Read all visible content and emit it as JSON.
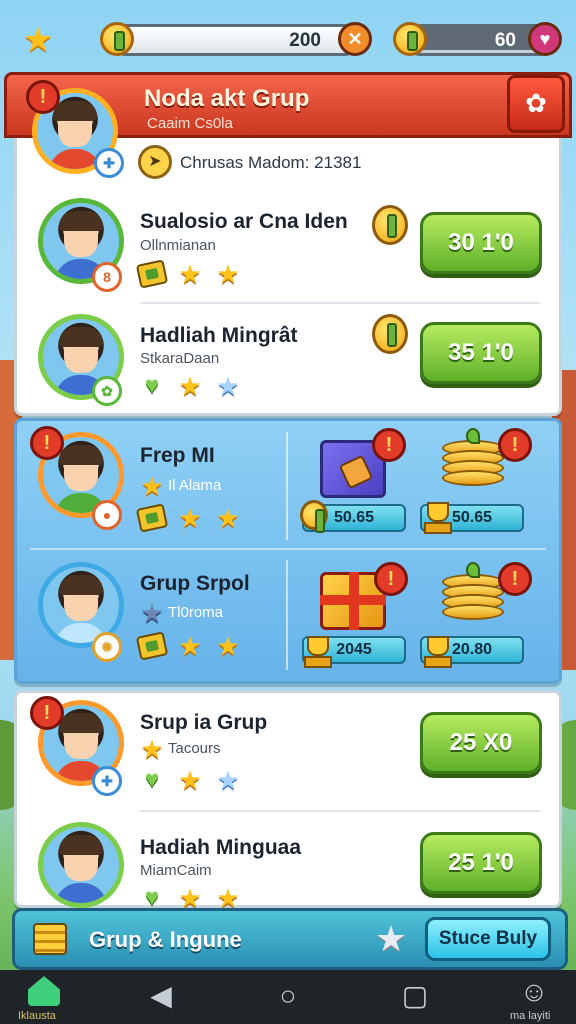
{
  "hud": {
    "currency1_value": "200",
    "currency2_value": "60"
  },
  "header": {
    "title": "Noda akt Grup",
    "subtitle": "Caaim Cs0la",
    "info": "Chrusas Madom: 21381"
  },
  "rows_top": [
    {
      "title": "Sualosio ar Cna Iden",
      "subtitle": "Ollnmianan",
      "button": "30 1'0"
    },
    {
      "title": "Hadliah Mingrât",
      "subtitle": "StkaraDaan",
      "button": "35 1'0"
    }
  ],
  "groups": [
    {
      "title": "Frep MI",
      "subtitle": "Il Alama",
      "item1_value": "50.65",
      "item2_value": "50.65"
    },
    {
      "title": "Grup Srpol",
      "subtitle": "Tl0roma",
      "item1_value": "2045",
      "item2_value": "20.80"
    }
  ],
  "rows_bottom": [
    {
      "title": "Srup ia Grup",
      "subtitle": "Tacours",
      "button": "25 X0"
    },
    {
      "title": "Hadiah Minguaa",
      "subtitle": "MiamCaim",
      "button": "25 1'0"
    }
  ],
  "bottom_bar": {
    "label": "Grup & Ingune",
    "button": "Stuce Buly"
  },
  "navbar": {
    "home_label": "Iklausta",
    "profile_label": "ma layiti"
  },
  "colors": {
    "header_red": "#d9452b",
    "button_green": "#6fbd33",
    "group_blue": "#72b8ec",
    "bottom_cyan": "#2fa6c8"
  },
  "icons": [
    "star-icon",
    "coin-icon",
    "alert-icon",
    "gift-icon",
    "coin-stack-icon",
    "trophy-icon",
    "heart-icon",
    "ticket-icon",
    "back-icon",
    "home-icon",
    "recents-icon",
    "profile-icon"
  ]
}
